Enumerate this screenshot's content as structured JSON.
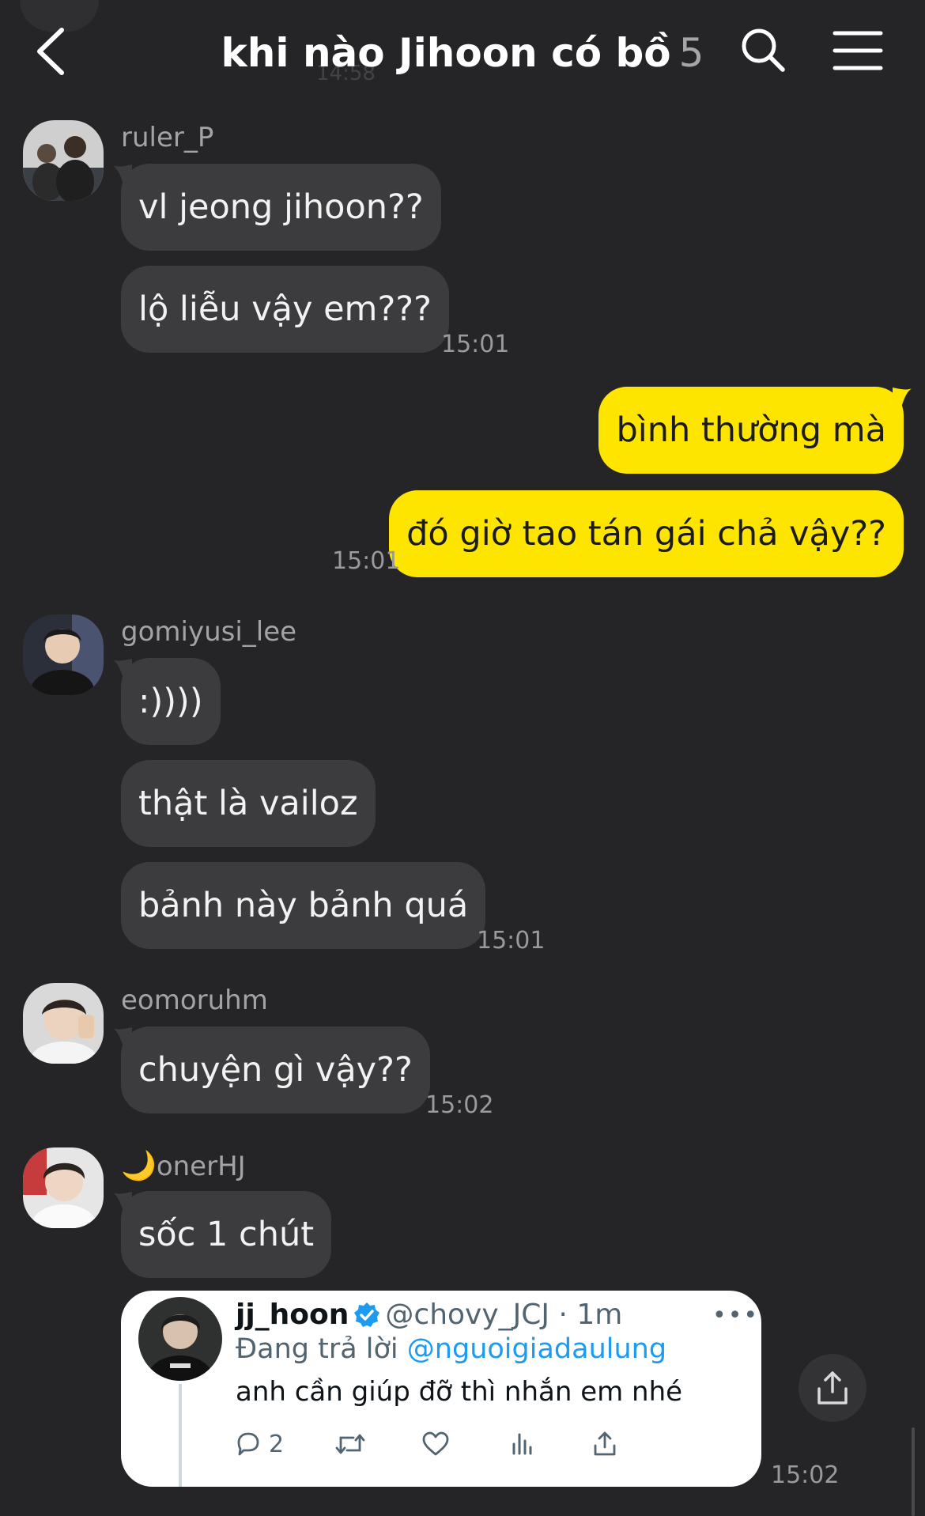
{
  "header": {
    "title": "khi nào Jihoon có bồ",
    "member_count": "5",
    "faded_timestamp": "14:58",
    "icons": {
      "back": "chevron-left-icon",
      "search": "search-icon",
      "menu": "hamburger-menu-icon"
    }
  },
  "messages": [
    {
      "sender": "ruler_P",
      "bubbles": [
        "vl jeong jihoon??",
        "lộ liễu vậy em???"
      ],
      "time": "15:01"
    },
    {
      "sender": "me",
      "bubbles": [
        "bình thường mà",
        "đó giờ tao tán gái chả vậy??"
      ],
      "time": "15:01"
    },
    {
      "sender": "gomiyusi_lee",
      "bubbles": [
        ":))))",
        "thật là vailoz",
        "bảnh này bảnh quá"
      ],
      "time": "15:01"
    },
    {
      "sender": "eomoruhm",
      "bubbles": [
        "chuyện gì vậy??"
      ],
      "time": "15:02"
    },
    {
      "sender_emoji": "🌙",
      "sender": "onerHJ",
      "bubbles": [
        "sốc 1 chút"
      ],
      "time": ""
    }
  ],
  "tweet": {
    "name": "jj_hoon",
    "verified_icon": "verified-badge-icon",
    "handle_meta": "@chovy_JCJ · 1m",
    "more": "•••",
    "reply_prefix": "Đang trả lời",
    "reply_to": "@nguoigiadaulung",
    "text": "anh cần giúp đỡ thì nhắn em nhé",
    "replies": "2",
    "icons": [
      "reply-icon",
      "retweet-icon",
      "like-icon",
      "views-icon",
      "share-icon"
    ],
    "time": "15:02"
  },
  "colors": {
    "background": "#252527",
    "incoming_bubble": "#3c3c3e",
    "outgoing_bubble": "#fee500",
    "link": "#1d9bf0"
  }
}
